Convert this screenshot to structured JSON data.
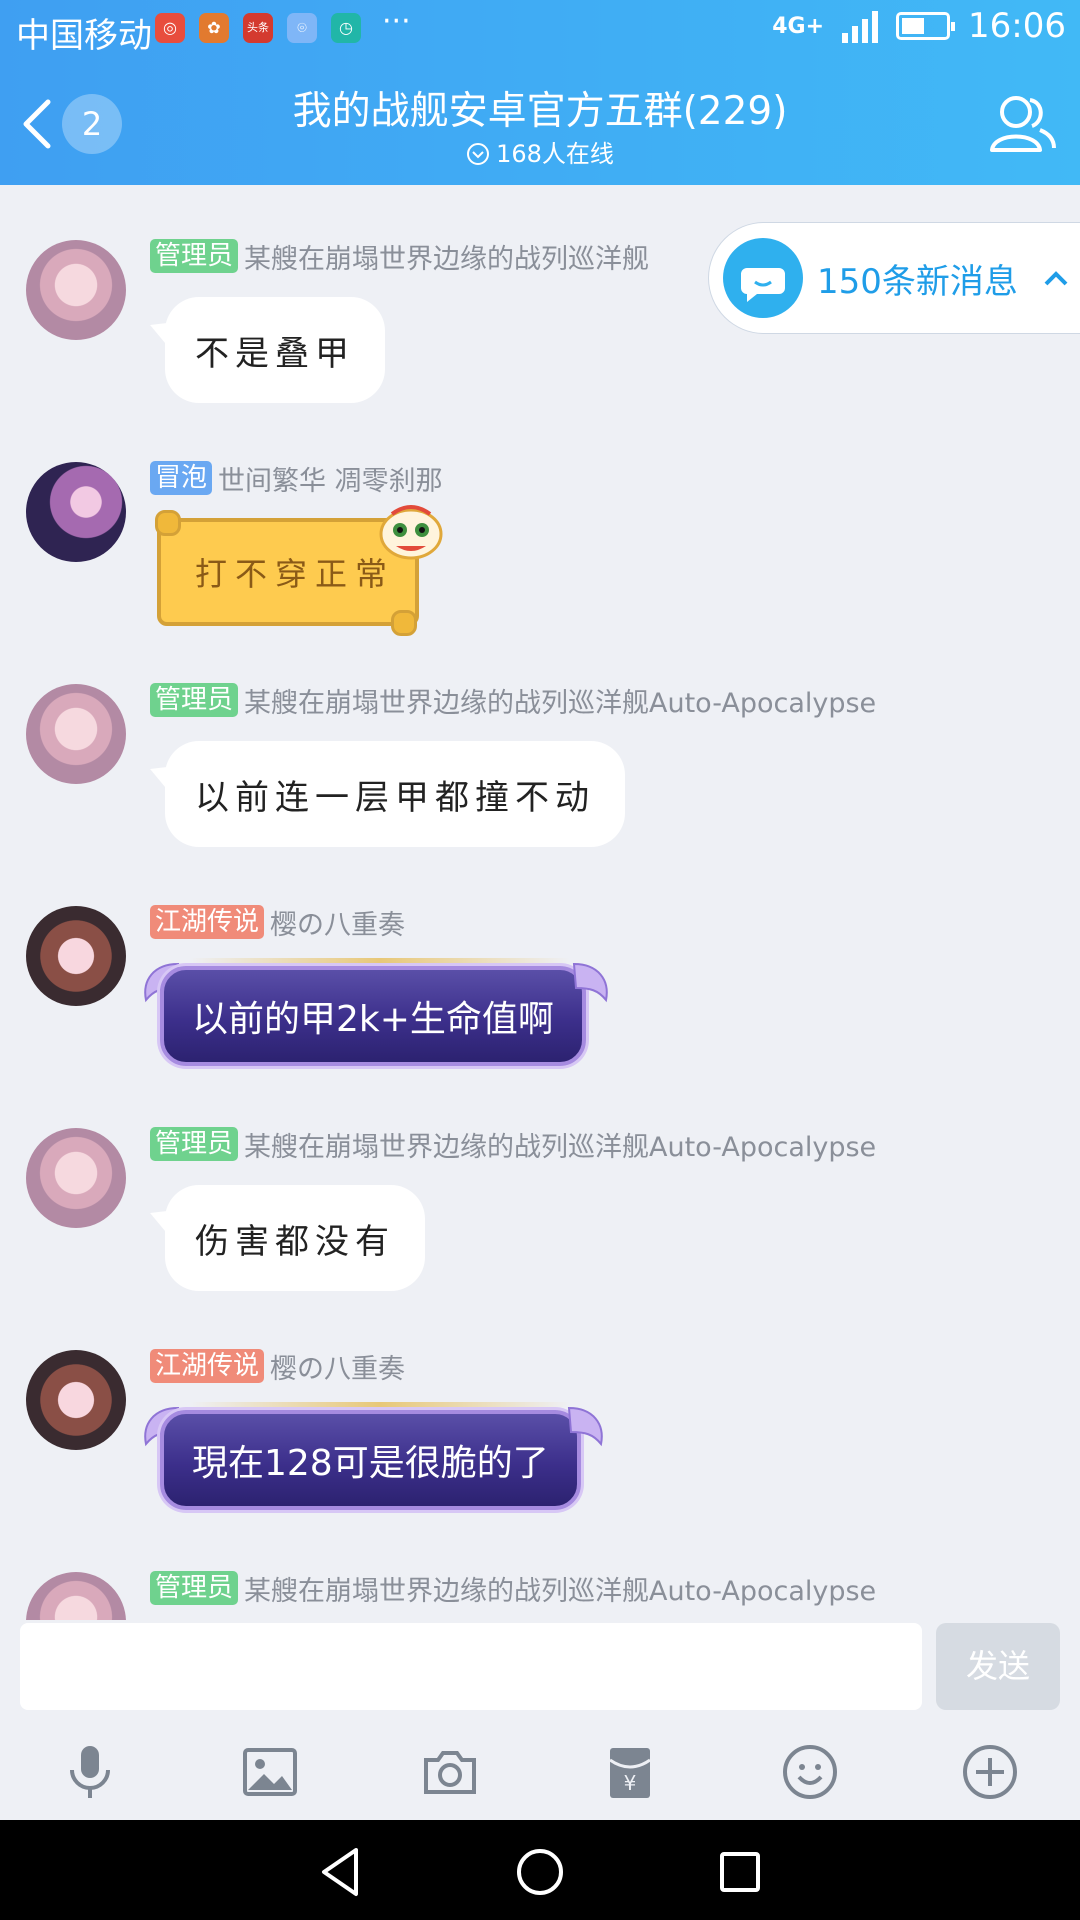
{
  "status_bar": {
    "carrier": "中国移动",
    "apps": [
      {
        "icon": "360-browser-icon",
        "color": "#e84d3d",
        "glyph": "◎"
      },
      {
        "icon": "weibo-icon",
        "color": "#e27a2f",
        "glyph": "✿"
      },
      {
        "icon": "toutiao-icon",
        "color": "#d43a2f",
        "glyph": "头条"
      },
      {
        "icon": "location-icon",
        "color": "#7fb6f7",
        "glyph": "⌾"
      },
      {
        "icon": "timer-icon",
        "color": "#21b6a8",
        "glyph": "◷"
      }
    ],
    "overflow": "···",
    "network": "4G+",
    "time": "16:06",
    "battery_level": 0.45
  },
  "header": {
    "back_badge": "2",
    "title": "我的战舰安卓官方五群(229)",
    "online": "168人在线"
  },
  "new_messages": "150条新消息",
  "messages": [
    {
      "tag": "管理员",
      "tag_type": "admin",
      "sender": "某艘在崩塌世界边缘的战列巡洋舰",
      "text": "不是叠甲",
      "style": "white",
      "avatar": "a"
    },
    {
      "tag": "冒泡",
      "tag_type": "bubble",
      "sender": "世间繁华  凋零刹那",
      "text": "打不穿正常",
      "style": "scroll",
      "avatar": "b"
    },
    {
      "tag": "管理员",
      "tag_type": "admin",
      "sender": "某艘在崩塌世界边缘的战列巡洋舰Auto-Apocalypse",
      "text": "以前连一层甲都撞不动",
      "style": "white",
      "avatar": "a"
    },
    {
      "tag": "江湖传说",
      "tag_type": "legend",
      "sender": "樱の八重奏",
      "text": "以前的甲2k+生命值啊",
      "style": "purple",
      "avatar": "c"
    },
    {
      "tag": "管理员",
      "tag_type": "admin",
      "sender": "某艘在崩塌世界边缘的战列巡洋舰Auto-Apocalypse",
      "text": "伤害都没有",
      "style": "white",
      "avatar": "a"
    },
    {
      "tag": "江湖传说",
      "tag_type": "legend",
      "sender": "樱の八重奏",
      "text": "現在128可是很脆的了",
      "style": "purple",
      "avatar": "c"
    },
    {
      "tag": "管理员",
      "tag_type": "admin",
      "sender": "某艘在崩塌世界边缘的战列巡洋舰Auto-Apocalypse",
      "text": "",
      "style": "none",
      "avatar": "a"
    }
  ],
  "input": {
    "value": "",
    "send_label": "发送"
  },
  "toolbar": [
    "microphone-icon",
    "image-icon",
    "camera-icon",
    "red-packet-icon",
    "emoji-icon",
    "plus-icon"
  ],
  "navbar": [
    "nav-back-icon",
    "nav-home-icon",
    "nav-recents-icon"
  ],
  "colors": {
    "header": "#41a8f4",
    "admin": "#6fd28e",
    "bubble_tag": "#6aa8f2",
    "legend": "#f08b79",
    "accent": "#1f9de8"
  }
}
